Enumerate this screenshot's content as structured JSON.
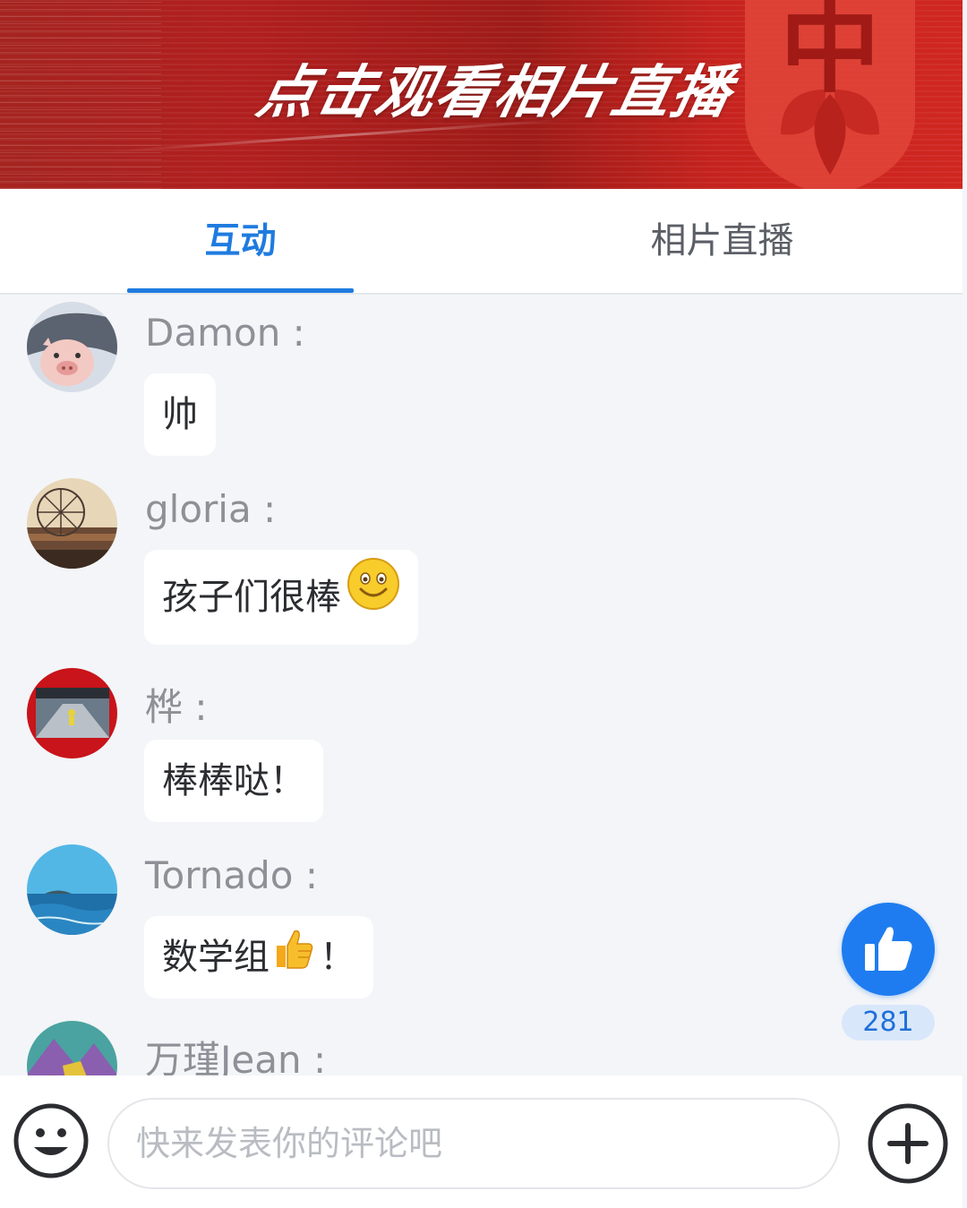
{
  "banner": {
    "title": "点击观看相片直播",
    "emblem_glyph": "中",
    "colors": {
      "background": "#b11f1f",
      "emblem": "#e0453a"
    }
  },
  "tabs": [
    {
      "label": "互动",
      "active": true
    },
    {
      "label": "相片直播",
      "active": false
    }
  ],
  "accent_color": "#1f7be0",
  "comments": [
    {
      "user": "Damon",
      "separator": " :",
      "text": "帅",
      "emoji": null,
      "avatar": "pig-avatar"
    },
    {
      "user": "gloria",
      "separator": " :",
      "text": "孩子们很棒",
      "emoji": "smile-emoji",
      "avatar": "ferris-wheel-avatar"
    },
    {
      "user": "桦",
      "separator": " :",
      "text": "棒棒哒！",
      "emoji": null,
      "avatar": "corridor-avatar"
    },
    {
      "user": "Tornado",
      "separator": " :",
      "text": "数学组",
      "emoji": "thumbs-up-emoji",
      "text_after": "！",
      "avatar": "sea-avatar"
    },
    {
      "user": "万瑾Jean",
      "separator": " :",
      "text": "",
      "emoji": null,
      "avatar": "mountain-avatar"
    }
  ],
  "like": {
    "icon": "thumbs-up-icon",
    "count": "281"
  },
  "bottom_bar": {
    "emoji_icon": "smiley-icon",
    "input_placeholder": "快来发表你的评论吧",
    "input_value": "",
    "plus_icon": "plus-circle-icon"
  }
}
